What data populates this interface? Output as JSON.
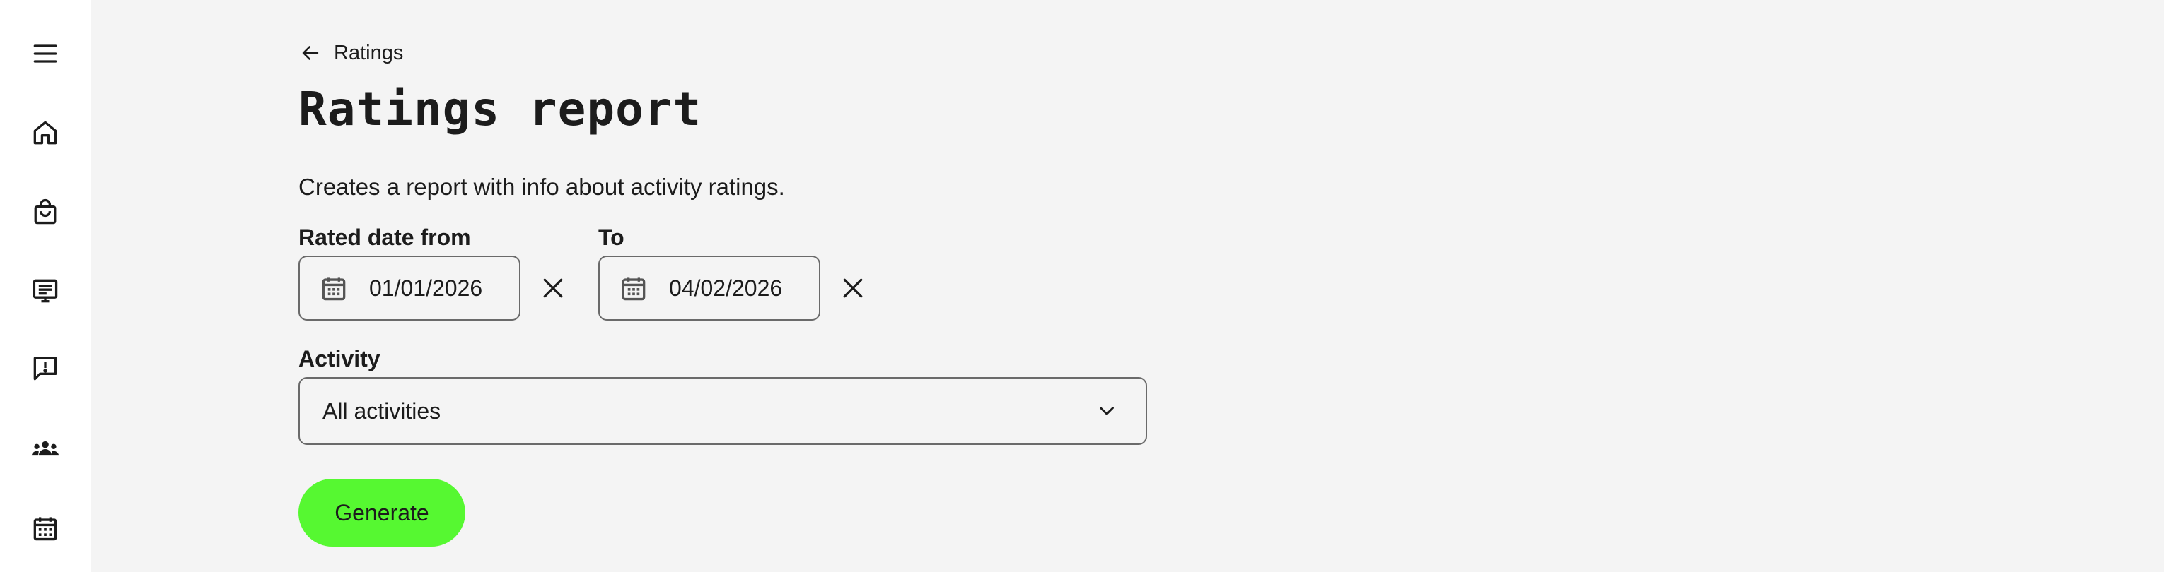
{
  "sidebar": {
    "items": [
      {
        "name": "menu",
        "icon": "hamburger-menu-icon"
      },
      {
        "name": "home",
        "icon": "home-icon"
      },
      {
        "name": "shop",
        "icon": "shopping-bag-icon"
      },
      {
        "name": "listings",
        "icon": "list-board-icon"
      },
      {
        "name": "reports",
        "icon": "alert-message-icon"
      },
      {
        "name": "users",
        "icon": "users-group-icon"
      },
      {
        "name": "calendar",
        "icon": "calendar-icon"
      }
    ]
  },
  "breadcrumb": {
    "back_label": "Ratings",
    "icon": "arrow-left-icon"
  },
  "page": {
    "title": "Ratings report",
    "description": "Creates a report with info about activity ratings."
  },
  "filters": {
    "from": {
      "label": "Rated date from",
      "value": "01/01/2026"
    },
    "to": {
      "label": "To",
      "value": "04/02/2026"
    },
    "activity": {
      "label": "Activity",
      "value": "All activities"
    }
  },
  "actions": {
    "generate_label": "Generate"
  },
  "colors": {
    "accent": "#56f831",
    "background": "#f4f4f4",
    "sidebar": "#ffffff",
    "text": "#1c1c1c"
  }
}
